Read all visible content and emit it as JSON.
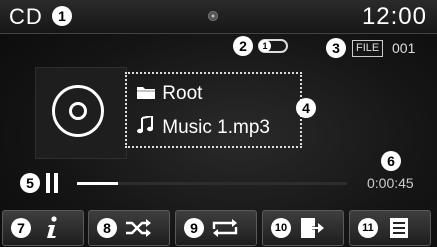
{
  "header": {
    "source": "CD",
    "clock": "12:00"
  },
  "callouts": {
    "c1": "1",
    "c2": "2",
    "c3": "3",
    "c4": "4",
    "c5": "5",
    "c6": "6",
    "c7": "7",
    "c8": "8",
    "c9": "9",
    "c10": "10",
    "c11": "11"
  },
  "status": {
    "repeat_one_glyph": "1",
    "file_label": "FILE",
    "file_number": "001"
  },
  "track": {
    "folder": "Root",
    "filename": "Music 1.mp3"
  },
  "playback": {
    "state": "paused",
    "elapsed": "0:00:45",
    "progress_fraction": 0.15
  },
  "buttons": [
    {
      "id": "info",
      "icon": "info-icon"
    },
    {
      "id": "shuffle",
      "icon": "shuffle-icon"
    },
    {
      "id": "repeat",
      "icon": "repeat-icon"
    },
    {
      "id": "copy",
      "icon": "copy-icon"
    },
    {
      "id": "list",
      "icon": "list-icon"
    }
  ]
}
